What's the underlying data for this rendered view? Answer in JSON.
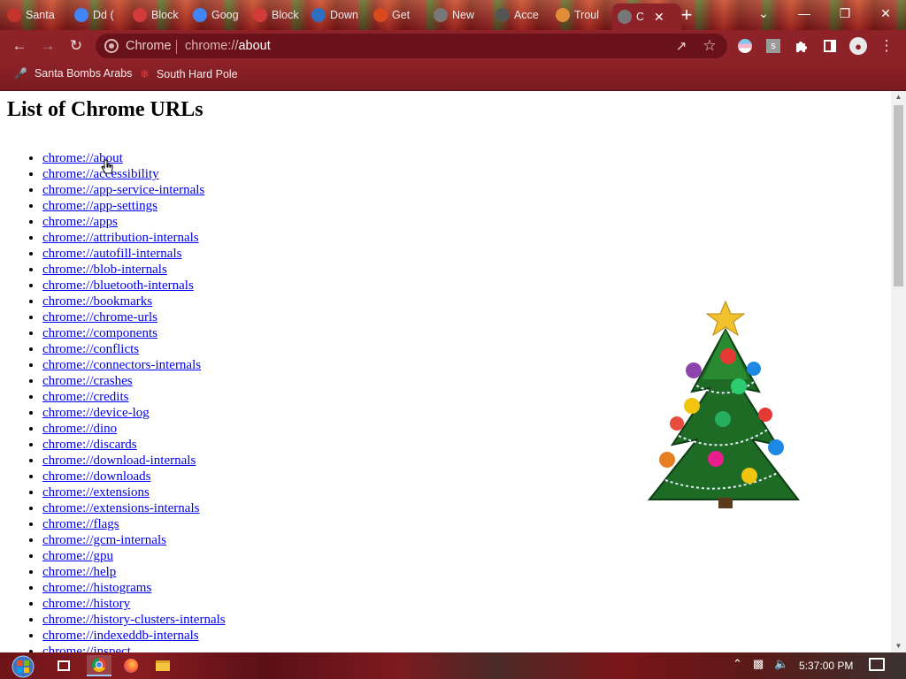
{
  "tabs": [
    {
      "label": "Santa",
      "favicon": "santa-icon",
      "color": "#c6332b"
    },
    {
      "label": "Dd (",
      "favicon": "google-icon",
      "color": "#4285f4"
    },
    {
      "label": "Block",
      "favicon": "shield-icon",
      "color": "#d33b3b"
    },
    {
      "label": "Goog",
      "favicon": "google-icon",
      "color": "#4285f4"
    },
    {
      "label": "Block",
      "favicon": "shield-icon",
      "color": "#d33b3b"
    },
    {
      "label": "Down",
      "favicon": "download-site-icon",
      "color": "#2f6fc0"
    },
    {
      "label": "Get",
      "favicon": "ublock-icon",
      "color": "#d84a1b"
    },
    {
      "label": "New",
      "favicon": "chrome-icon",
      "color": "#777777"
    },
    {
      "label": "Acce",
      "favicon": "settings-icon",
      "color": "#555555"
    },
    {
      "label": "Troul",
      "favicon": "triangle-icon",
      "color": "#e28b3a"
    },
    {
      "label": "C",
      "favicon": "chrome-icon",
      "color": "#777777"
    }
  ],
  "omnibox": {
    "site_label": "Chrome",
    "url_prefix": "chrome://",
    "url_host": "about"
  },
  "bookmarks": [
    {
      "label": "Santa Bombs Arabs",
      "icon": "mic-icon"
    },
    {
      "label": "South Hard Pole",
      "icon": "snowflake-icon"
    }
  ],
  "page": {
    "title": "List of Chrome URLs",
    "urls": [
      "chrome://about",
      "chrome://accessibility",
      "chrome://app-service-internals",
      "chrome://app-settings",
      "chrome://apps",
      "chrome://attribution-internals",
      "chrome://autofill-internals",
      "chrome://blob-internals",
      "chrome://bluetooth-internals",
      "chrome://bookmarks",
      "chrome://chrome-urls",
      "chrome://components",
      "chrome://conflicts",
      "chrome://connectors-internals",
      "chrome://crashes",
      "chrome://credits",
      "chrome://device-log",
      "chrome://dino",
      "chrome://discards",
      "chrome://download-internals",
      "chrome://downloads",
      "chrome://extensions",
      "chrome://extensions-internals",
      "chrome://flags",
      "chrome://gcm-internals",
      "chrome://gpu",
      "chrome://help",
      "chrome://histograms",
      "chrome://history",
      "chrome://history-clusters-internals",
      "chrome://indexeddb-internals",
      "chrome://inspect"
    ]
  },
  "taskbar": {
    "clock": "5:37:00 PM"
  },
  "colors": {
    "link": "#0000ee",
    "toolbar": "#8d2228"
  }
}
